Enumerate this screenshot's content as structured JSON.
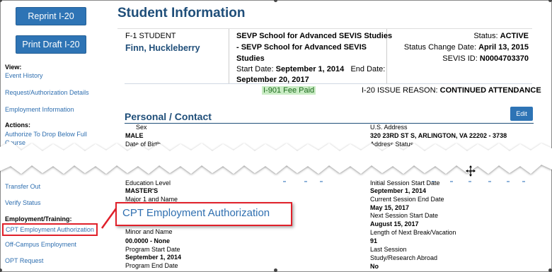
{
  "sidebar": {
    "buttons": [
      "Reprint I-20",
      "Print Draft I-20"
    ],
    "view_heading": "View:",
    "view_links": [
      "Event History",
      "Request/Authorization Details",
      "Employment Information"
    ],
    "actions_heading": "Actions:",
    "actions_link_line1": "Authorize To Drop Below Full",
    "actions_link_line2": "Course",
    "links_lower": [
      "Transfer Out",
      "Verify Status"
    ],
    "employment_heading": "Employment/Training:",
    "employment_links": [
      "CPT Employment Authorization",
      "Off-Campus Employment",
      "OPT Request"
    ]
  },
  "page_title": "Student Information",
  "student": {
    "type": "F-1 STUDENT",
    "name": "Finn, Huckleberry"
  },
  "school": {
    "line1": "SEVP School for Advanced SEVIS Studies",
    "line2": "- SEVP School for Advanced SEVIS",
    "line3": "Studies",
    "start_label": "Start Date:",
    "start_value": "September 1, 2014",
    "end_label": "End Date:",
    "end_value": "September 20, 2017"
  },
  "status": {
    "status_label": "Status:",
    "status_value": "ACTIVE",
    "change_label": "Status Change Date:",
    "change_value": "April 13, 2015",
    "sevis_label": "SEVIS ID:",
    "sevis_value": "N0004703370"
  },
  "fee_paid": "I-901 Fee Paid",
  "issue_reason_label": "I-20 ISSUE REASON:",
  "issue_reason_value": "CONTINUED ATTENDANCE",
  "section_title": "Personal / Contact",
  "edit_label": "Edit",
  "personal": {
    "sex_label": "Sex",
    "sex_value": "MALE",
    "dob_label": "Date of Birth",
    "us_address_label": "U.S. Address",
    "us_address_value": "320 23RD ST S,  ARLINGTON,  VA 22202 - 3738",
    "address_status_label": "Address Status"
  },
  "education": {
    "level_label": "Education Level",
    "level_value": "MASTER'S",
    "major1_label": "Major 1 and Name",
    "minor_label": "Minor and Name",
    "minor_value": "00.0000 - None",
    "program_start_label": "Program Start Date",
    "program_start_value": "September 1, 2014",
    "program_end_label": "Program End Date"
  },
  "session": {
    "initial_label": "Initial Session Start Date",
    "initial_value": "September 1, 2014",
    "current_label": "Current Session End Date",
    "current_value": "May 15, 2017",
    "next_label": "Next Session Start Date",
    "next_value": "August 15, 2017",
    "break_label": "Length of Next Break/Vacation",
    "break_value": "91",
    "last_label": "Last Session",
    "abroad_label": "Study/Research Abroad",
    "abroad_value": "No"
  },
  "callout_label": "CPT Employment Authorization",
  "colors": {
    "accent": "#2e74b5",
    "title": "#1f4e79",
    "link": "#2f6fb0",
    "callout_border": "#e0202a",
    "fee_bg": "#c9ecc4"
  }
}
